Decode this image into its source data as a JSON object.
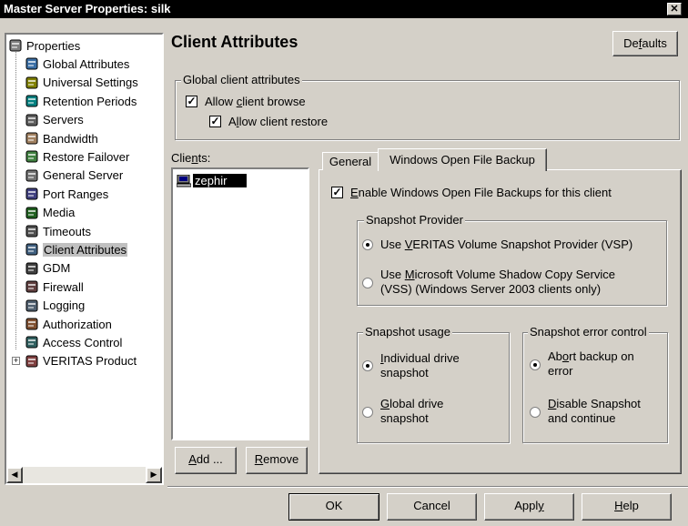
{
  "window": {
    "title": "Master Server Properties: silk",
    "close": "✕"
  },
  "tree": {
    "items": [
      {
        "label": "Properties",
        "icon": "properties-icon"
      },
      {
        "label": "Global Attributes",
        "icon": "global-attributes-icon"
      },
      {
        "label": "Universal Settings",
        "icon": "universal-settings-icon"
      },
      {
        "label": "Retention Periods",
        "icon": "retention-periods-icon"
      },
      {
        "label": "Servers",
        "icon": "servers-icon"
      },
      {
        "label": "Bandwidth",
        "icon": "bandwidth-icon"
      },
      {
        "label": "Restore Failover",
        "icon": "restore-failover-icon"
      },
      {
        "label": "General Server",
        "icon": "general-server-icon"
      },
      {
        "label": "Port Ranges",
        "icon": "port-ranges-icon"
      },
      {
        "label": "Media",
        "icon": "media-icon"
      },
      {
        "label": "Timeouts",
        "icon": "timeouts-icon"
      },
      {
        "label": "Client Attributes",
        "icon": "client-attributes-icon",
        "selected": true
      },
      {
        "label": "GDM",
        "icon": "gdm-icon"
      },
      {
        "label": "Firewall",
        "icon": "firewall-icon"
      },
      {
        "label": "Logging",
        "icon": "logging-icon"
      },
      {
        "label": "Authorization",
        "icon": "authorization-icon"
      },
      {
        "label": "Access Control",
        "icon": "access-control-icon"
      },
      {
        "label": "VERITAS Product",
        "icon": "veritas-product-icon",
        "expander": "+"
      }
    ]
  },
  "header": {
    "title": "Client Attributes",
    "defaults_pre": "De",
    "defaults_u": "f",
    "defaults_post": "aults"
  },
  "global_group": {
    "legend": "Global client attributes",
    "browse_pre": "Allow ",
    "browse_u": "c",
    "browse_post": "lient browse",
    "restore_pre": "A",
    "restore_u": "l",
    "restore_post": "low client restore"
  },
  "clients": {
    "label_pre": "Clie",
    "label_u": "n",
    "label_post": "ts:",
    "items": [
      "zephir"
    ],
    "add_pre": "",
    "add_u": "A",
    "add_post": "dd ...",
    "remove_pre": "",
    "remove_u": "R",
    "remove_post": "emove"
  },
  "tabs": {
    "general": "General",
    "wofb": "Windows Open File Backup"
  },
  "wofb": {
    "enable_pre": "",
    "enable_u": "E",
    "enable_post": "nable Windows Open File Backups for this client",
    "provider_legend": "Snapshot Provider",
    "vsp_pre": "Use ",
    "vsp_u": "V",
    "vsp_post": "ERITAS Volume Snapshot Provider (VSP)",
    "vss1_pre": "Use ",
    "vss1_u": "M",
    "vss1_post": "icrosoft Volume Shadow Copy Service",
    "vss2": "(VSS) (Windows Server 2003 clients only)",
    "usage_legend": "Snapshot usage",
    "indiv1_pre": "",
    "indiv1_u": "I",
    "indiv1_post": "ndividual drive",
    "indiv2": "snapshot",
    "global1_pre": "",
    "global1_u": "G",
    "global1_post": "lobal drive",
    "global2": "snapshot",
    "error_legend": "Snapshot error control",
    "abort1_pre": "Ab",
    "abort1_u": "o",
    "abort1_post": "rt backup on",
    "abort2": "error",
    "disable1_pre": "",
    "disable1_u": "D",
    "disable1_post": "isable Snapshot",
    "disable2": "and continue"
  },
  "footer": {
    "ok": "OK",
    "cancel": "Cancel",
    "apply_pre": "Appl",
    "apply_u": "y",
    "apply_post": "",
    "help_pre": "",
    "help_u": "H",
    "help_post": "elp"
  }
}
